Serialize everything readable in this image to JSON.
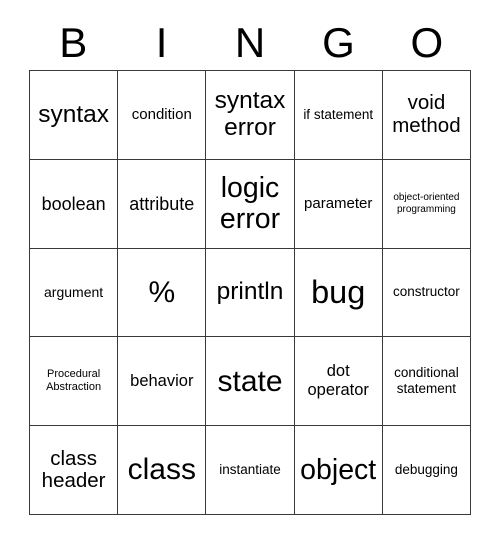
{
  "card": {
    "title": "BINGO",
    "header_letters": [
      "B",
      "I",
      "N",
      "G",
      "O"
    ],
    "rows": [
      [
        {
          "text": "syntax",
          "size": "fs-24"
        },
        {
          "text": "condition",
          "size": "fs-15"
        },
        {
          "text": "syntax error",
          "size": "fs-24"
        },
        {
          "text": "if statement",
          "size": "fs-13"
        },
        {
          "text": "void method",
          "size": "fs-20"
        }
      ],
      [
        {
          "text": "boolean",
          "size": "fs-18"
        },
        {
          "text": "attribute",
          "size": "fs-18"
        },
        {
          "text": "logic error",
          "size": "fs-28"
        },
        {
          "text": "parameter",
          "size": "fs-15"
        },
        {
          "text": "object-oriented programming",
          "size": "fs-10"
        }
      ],
      [
        {
          "text": "argument",
          "size": "fs-14"
        },
        {
          "text": "%",
          "size": "fs-30"
        },
        {
          "text": "println",
          "size": "fs-24"
        },
        {
          "text": "bug",
          "size": "fs-32"
        },
        {
          "text": "constructor",
          "size": "fs-13"
        }
      ],
      [
        {
          "text": "Procedural Abstraction",
          "size": "fs-11"
        },
        {
          "text": "behavior",
          "size": "fs-16"
        },
        {
          "text": "state",
          "size": "fs-30"
        },
        {
          "text": "dot operator",
          "size": "fs-16"
        },
        {
          "text": "conditional statement",
          "size": "fs-13"
        }
      ],
      [
        {
          "text": "class header",
          "size": "fs-20"
        },
        {
          "text": "class",
          "size": "fs-30"
        },
        {
          "text": "instantiate",
          "size": "fs-13"
        },
        {
          "text": "object",
          "size": "fs-28"
        },
        {
          "text": "debugging",
          "size": "fs-13"
        }
      ]
    ]
  },
  "colors": {
    "background": "#ffffff",
    "text": "#000000",
    "border": "#3a3a3a"
  }
}
